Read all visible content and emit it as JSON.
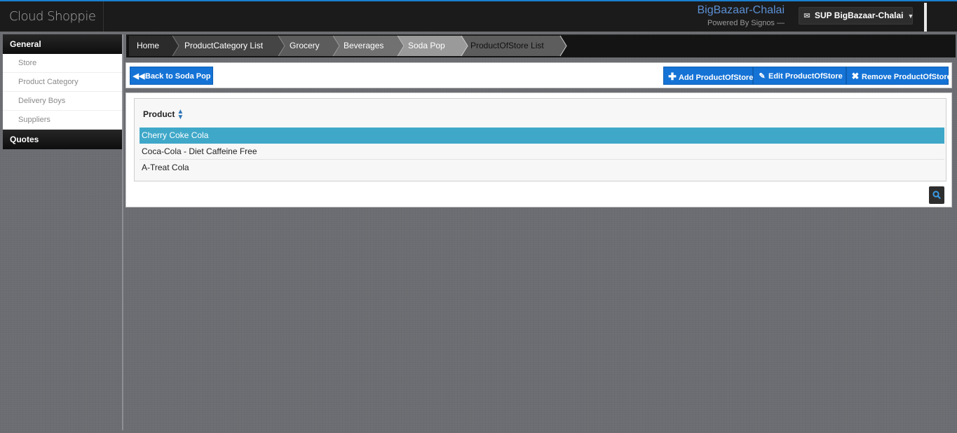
{
  "header": {
    "brand": "Cloud Shoppie",
    "store_name": "BigBazaar-Chalai",
    "powered_by": "Powered By Signos —",
    "user_menu": "SUP BigBazaar-Chalai"
  },
  "sidebar": {
    "sections": [
      {
        "title": "General",
        "items": [
          "Store",
          "Product Category",
          "Delivery Boys",
          "Suppliers"
        ]
      },
      {
        "title": "Quotes",
        "items": []
      }
    ]
  },
  "breadcrumb": [
    "Home",
    "ProductCategory List",
    "Grocery",
    "Beverages",
    "Soda Pop",
    "ProductOfStore List"
  ],
  "toolbar": {
    "back": "Back to Soda Pop",
    "add": "Add ProductOfStore",
    "edit": "Edit ProductOfStore",
    "remove": "Remove ProductOfStore"
  },
  "grid": {
    "column": "Product",
    "rows": [
      "Cherry Coke Cola",
      "Coca-Cola - Diet Caffeine Free",
      "A-Treat Cola"
    ],
    "selected_index": 0
  },
  "colors": {
    "accent_blue": "#1573d6",
    "selected_row": "#3fa8c9",
    "topbar": "#1b1b1b"
  }
}
